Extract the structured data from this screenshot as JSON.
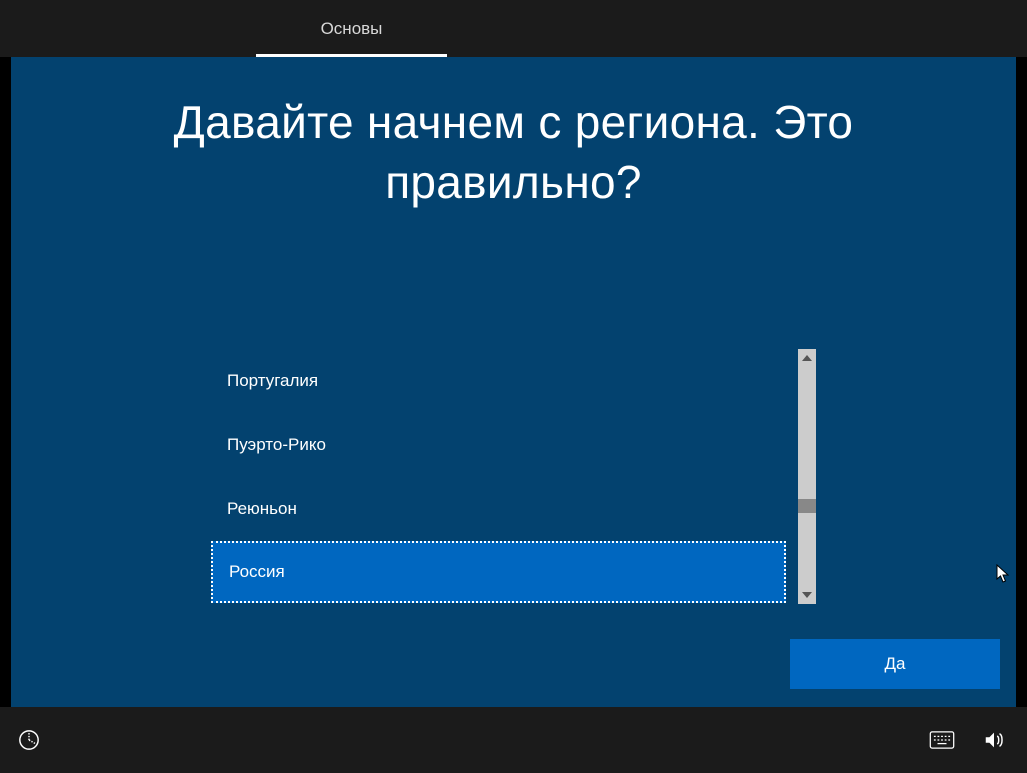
{
  "topbar": {
    "tab_label": "Основы"
  },
  "heading": "Давайте начнем с региона. Это\nправильно?",
  "region_list": {
    "items": [
      {
        "label": "Португалия",
        "selected": false
      },
      {
        "label": "Пуэрто-Рико",
        "selected": false
      },
      {
        "label": "Реюньон",
        "selected": false
      },
      {
        "label": "Россия",
        "selected": true
      }
    ]
  },
  "buttons": {
    "yes": "Да"
  },
  "icons": {
    "ease_of_access": "ease-of-access-icon",
    "keyboard": "keyboard-icon",
    "volume": "volume-icon"
  }
}
